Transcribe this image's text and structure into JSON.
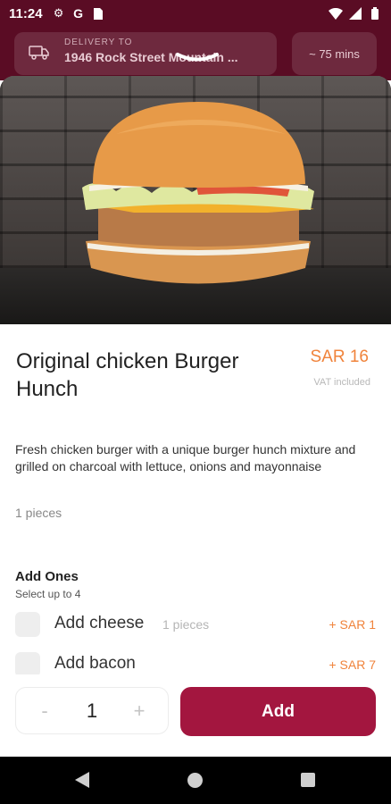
{
  "status_bar": {
    "time": "11:24",
    "left_icons": [
      "gear-icon",
      "google-icon",
      "sim-icon"
    ],
    "right_icons": [
      "wifi-icon",
      "signal-icon",
      "battery-icon"
    ]
  },
  "header": {
    "delivery_label": "DELIVERY TO",
    "delivery_address": "1946 Rock Street Mountain ...",
    "eta": "~ 75 mins"
  },
  "product": {
    "title": "Original chicken Burger Hunch",
    "price": "SAR 16",
    "vat_note": "VAT included",
    "description": "Fresh chicken burger with a unique burger hunch mixture and grilled on charcoal with lettuce, onions and mayonnaise",
    "pieces": "1 pieces"
  },
  "addons": {
    "title": "Add Ones",
    "subtitle": "Select up to 4",
    "items": [
      {
        "name": "Add cheese",
        "meta": "1 pieces",
        "price": "+ SAR 1",
        "checked": false
      },
      {
        "name": "Add bacon",
        "meta": "",
        "price": "+ SAR 7",
        "checked": false
      }
    ]
  },
  "footer": {
    "minus": "-",
    "quantity": "1",
    "plus": "+",
    "add_label": "Add"
  },
  "colors": {
    "brand": "#a3163f",
    "accent": "#f0833b",
    "header": "#5a0c24"
  }
}
